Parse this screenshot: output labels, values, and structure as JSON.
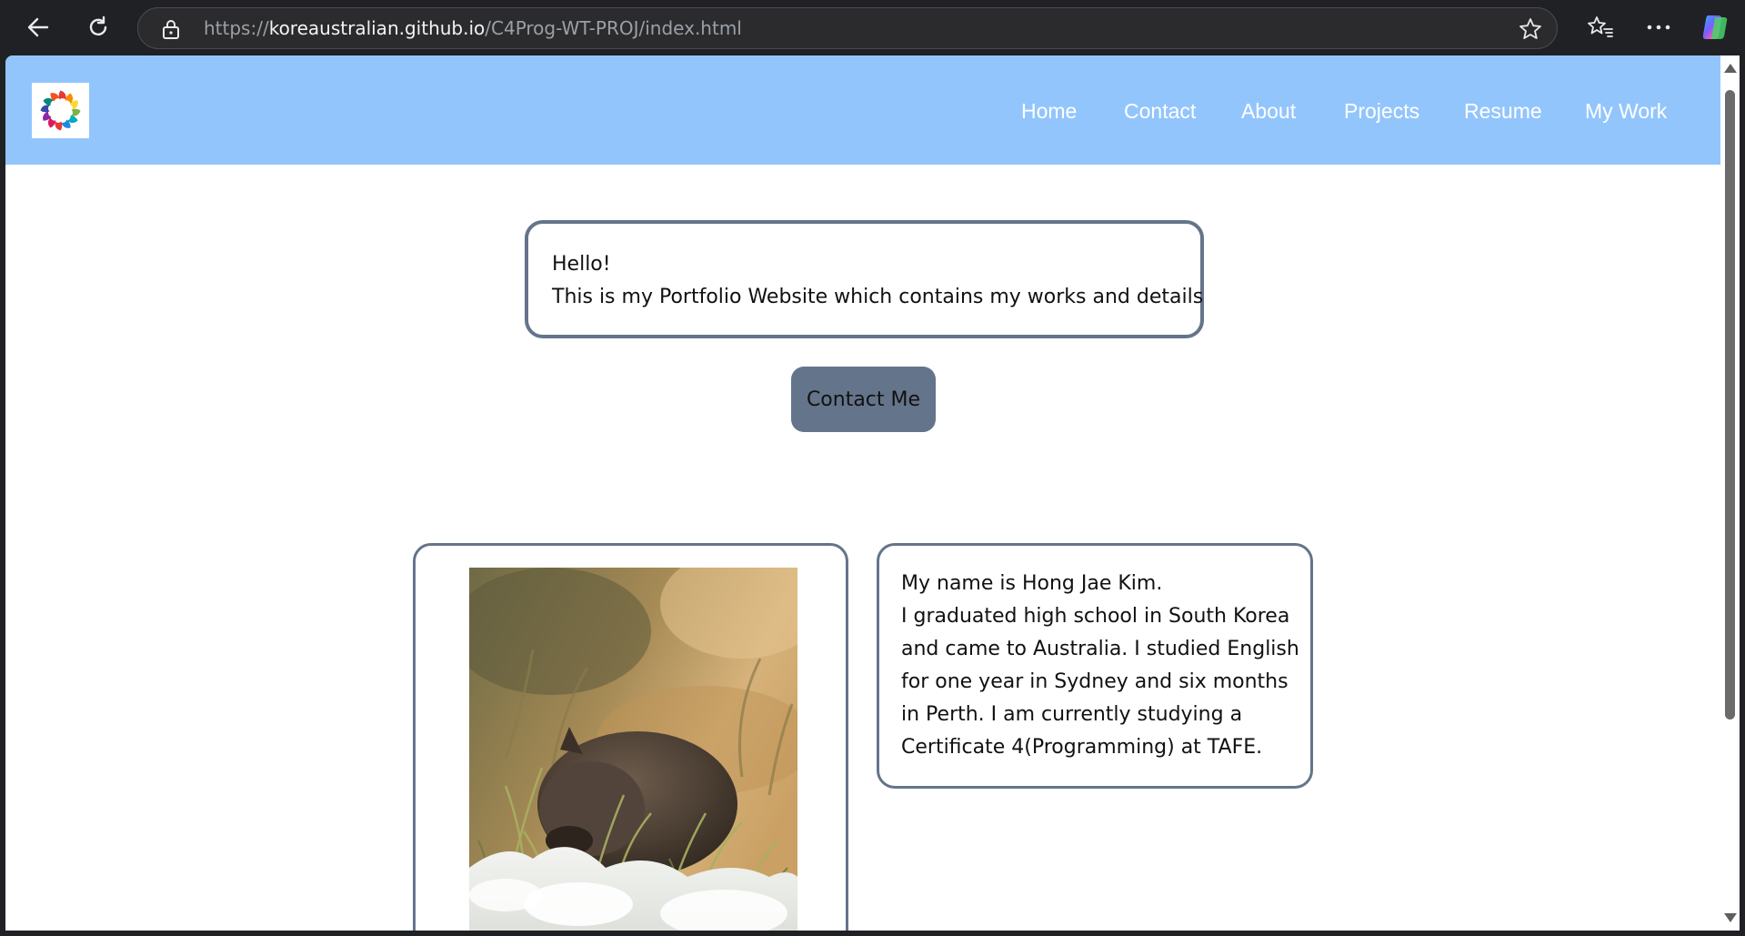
{
  "browser": {
    "url_scheme": "https://",
    "url_host": "koreaustralian.github.io",
    "url_path": "/C4Prog-WT-PROJ/index.html",
    "icons": [
      "back-icon",
      "refresh-icon",
      "lock-icon",
      "star-icon",
      "favorites-icon",
      "more-icon",
      "copilot-icon"
    ]
  },
  "site": {
    "header_color": "#93c5fd",
    "accent_color": "#64748b",
    "nav": [
      "Home",
      "Contact",
      "About",
      "Projects",
      "Resume",
      "My Work"
    ]
  },
  "intro": {
    "line1": "Hello!",
    "line2": "This is my Portfolio Website which contains my works and details"
  },
  "contact_button": "Contact Me",
  "bio": {
    "lines": [
      "My name is Hong Jae Kim.",
      "I graduated high school in South Korea",
      "and came to Australia. I studied English",
      "for one year in Sydney and six months",
      "in Perth. I am currently studying a",
      "Certificate 4(Programming) at TAFE."
    ]
  }
}
